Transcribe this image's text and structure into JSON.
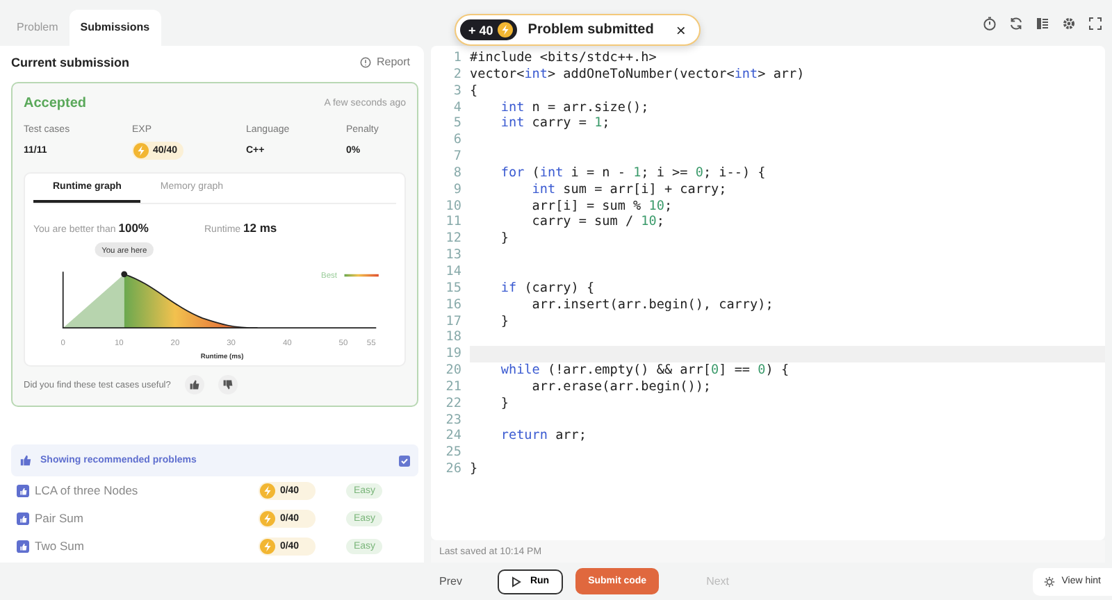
{
  "left_tabs": [
    {
      "label": "Problem",
      "selected": false
    },
    {
      "label": "Submissions",
      "selected": true
    }
  ],
  "submission": {
    "title": "Current submission",
    "report": "Report",
    "status": "Accepted",
    "time": "A few seconds ago",
    "stats": [
      {
        "label": "Test cases",
        "value": "11/11",
        "kind": "text"
      },
      {
        "label": "EXP",
        "value": "40/40",
        "kind": "exp"
      },
      {
        "label": "Language",
        "value": "C++",
        "kind": "text"
      },
      {
        "label": "Penalty",
        "value": "0%",
        "kind": "text"
      }
    ],
    "graph_tabs": [
      {
        "label": "Runtime graph",
        "selected": true
      },
      {
        "label": "Memory graph",
        "selected": false
      }
    ],
    "better_label": "You are better than",
    "better_value": "100%",
    "runtime_label": "Runtime",
    "runtime_value": "12 ms",
    "graph": {
      "marker": "You are here",
      "legend": "Best",
      "ticks": [
        "0",
        "10",
        "20",
        "30",
        "40",
        "50",
        "55"
      ],
      "xlabel": "Runtime (ms)"
    },
    "feedback": "Did you find these test cases useful?"
  },
  "recommended": {
    "label": "Showing recommended problems",
    "checked": true,
    "problems": [
      {
        "title": "LCA of three Nodes",
        "exp": "0/40",
        "difficulty": "Easy"
      },
      {
        "title": "Pair Sum",
        "exp": "0/40",
        "difficulty": "Easy"
      },
      {
        "title": "Two Sum",
        "exp": "0/40",
        "difficulty": "Easy"
      }
    ]
  },
  "toast": {
    "points": "+ 40",
    "message": "Problem submitted",
    "close": "×"
  },
  "code": [
    {
      "n": "1",
      "text": "#include <bits/stdc++.h>",
      "active": false
    },
    {
      "n": "2",
      "text": "vector<int> addOneToNumber(vector<int> arr)",
      "active": false
    },
    {
      "n": "3",
      "text": "{",
      "active": false
    },
    {
      "n": "4",
      "text": "    int n = arr.size();",
      "active": false
    },
    {
      "n": "5",
      "text": "    int carry = 1;",
      "active": false
    },
    {
      "n": "6",
      "active": false
    },
    {
      "n": "7",
      "active": false
    },
    {
      "n": "8",
      "text": "    for (int i = n - 1; i >= 0; i--) {",
      "active": false
    },
    {
      "n": "9",
      "text": "        int sum = arr[i] + carry;",
      "active": false
    },
    {
      "n": "10",
      "text": "        arr[i] = sum % 10;",
      "active": false
    },
    {
      "n": "11",
      "text": "        carry = sum / 10;",
      "active": false
    },
    {
      "n": "12",
      "text": "    }",
      "active": false
    },
    {
      "n": "13",
      "active": false
    },
    {
      "n": "14",
      "active": false
    },
    {
      "n": "15",
      "text": "    if (carry) {",
      "active": false
    },
    {
      "n": "16",
      "text": "        arr.insert(arr.begin(), carry);",
      "active": false
    },
    {
      "n": "17",
      "text": "    }",
      "active": false
    },
    {
      "n": "18",
      "active": false
    },
    {
      "n": "19",
      "active": true
    },
    {
      "n": "20",
      "text": "    while (!arr.empty() && arr[0] == 0) {",
      "active": false
    },
    {
      "n": "21",
      "text": "        arr.erase(arr.begin());",
      "active": false
    },
    {
      "n": "22",
      "text": "    }",
      "active": false
    },
    {
      "n": "23",
      "active": false
    },
    {
      "n": "24",
      "text": "    return arr;",
      "active": false
    },
    {
      "n": "25",
      "active": false
    },
    {
      "n": "26",
      "text": "}",
      "active": false
    }
  ],
  "last_saved": "Last saved at 10:14 PM",
  "footer": {
    "prev": "Prev",
    "run": "Run",
    "submit": "Submit code",
    "next": {
      "label": "Next",
      "disabled": true
    },
    "hint": "View hint"
  }
}
